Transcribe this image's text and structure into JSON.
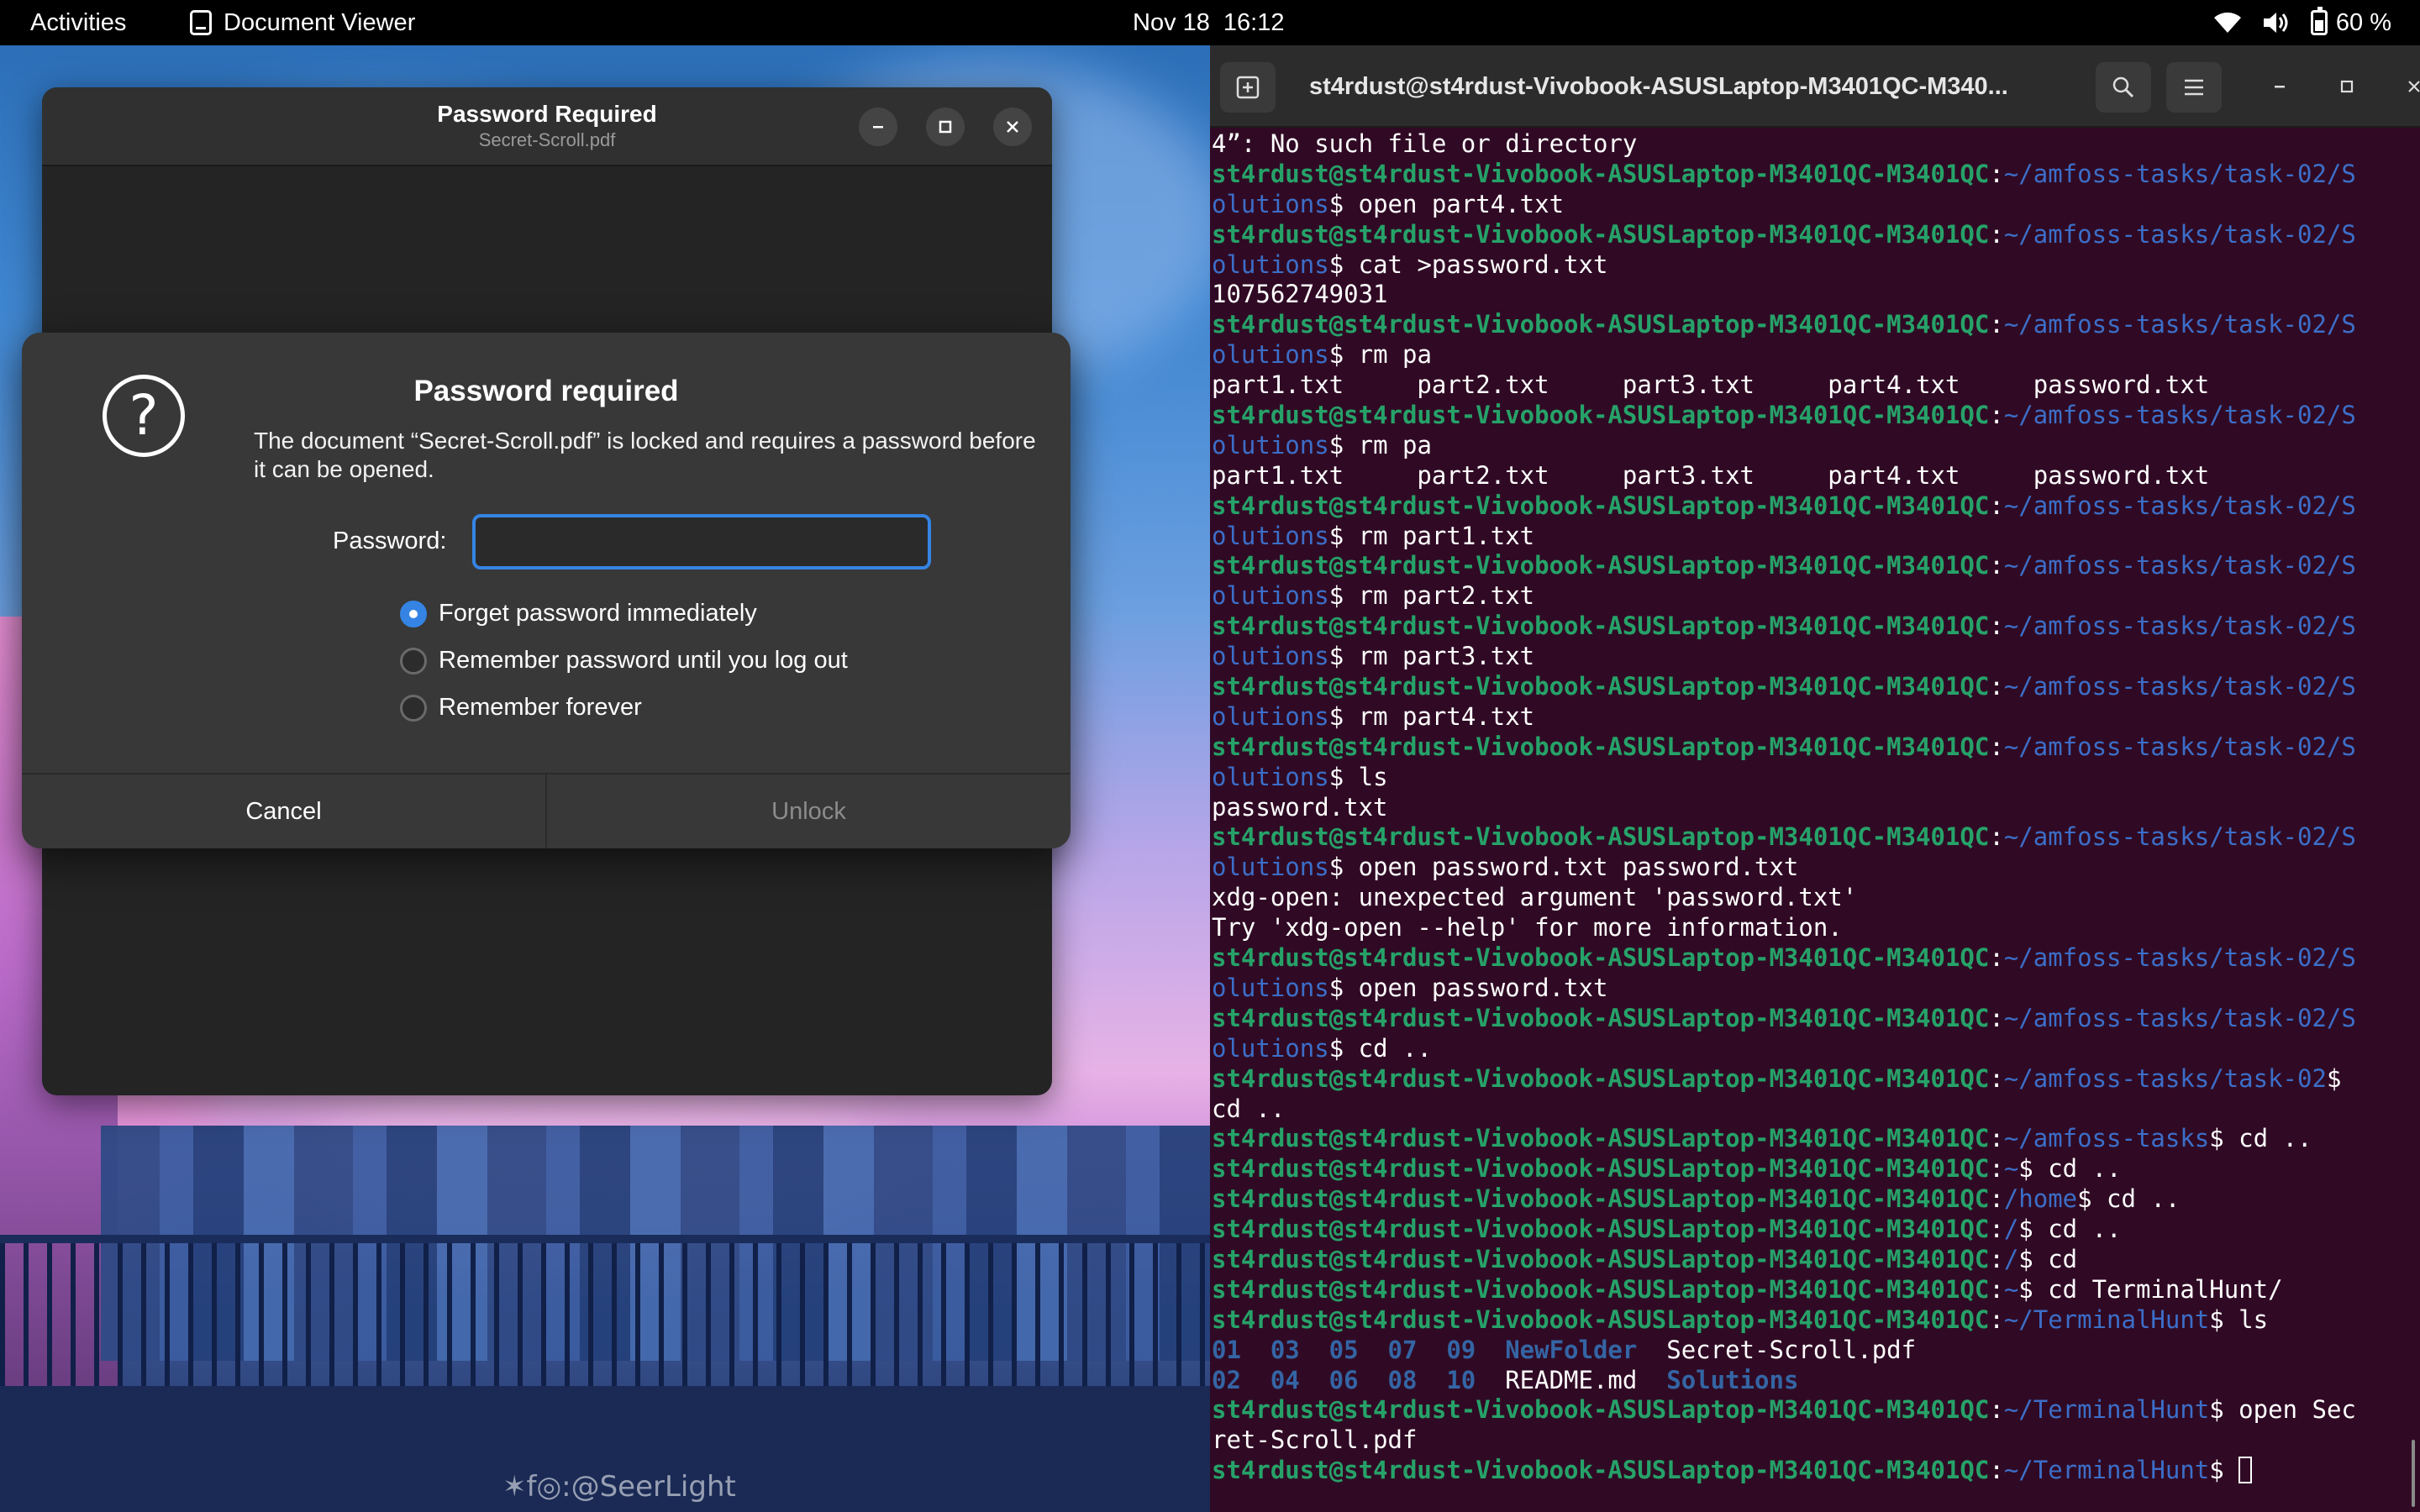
{
  "topbar": {
    "activities": "Activities",
    "app_name": "Document Viewer",
    "date": "Nov 18",
    "time": "16:12",
    "battery": "60 %"
  },
  "wallpaper": {
    "signature": "✶f◎:@SeerLight"
  },
  "viewer": {
    "title": "Password Required",
    "subtitle": "Secret-Scroll.pdf"
  },
  "dialog": {
    "title": "Password required",
    "message": "The document “Secret-Scroll.pdf” is locked and requires a password before it can be opened.",
    "password_label": "Password:",
    "password_value": "",
    "options": [
      {
        "label": "Forget password immediately",
        "checked": true
      },
      {
        "label": "Remember password until you log out",
        "checked": false
      },
      {
        "label": "Remember forever",
        "checked": false
      }
    ],
    "cancel": "Cancel",
    "unlock": "Unlock"
  },
  "terminal": {
    "title": "st4rdust@st4rdust-Vivobook-ASUSLaptop-M3401QC-M340...",
    "colors": {
      "background": "#300a24",
      "user": "#26a269",
      "path": "#3c6ec8"
    },
    "lines": [
      [
        {
          "t": "4”: No such file or directory"
        }
      ],
      [
        {
          "t": "st4rdust@st4rdust-Vivobook-ASUSLaptop-M3401QC-M3401QC",
          "c": "user"
        },
        {
          "t": ":"
        },
        {
          "t": "~/amfoss-tasks/task-02/S",
          "c": "path"
        }
      ],
      [
        {
          "t": "olutions",
          "c": "path"
        },
        {
          "t": "$ open part4.txt"
        }
      ],
      [
        {
          "t": "st4rdust@st4rdust-Vivobook-ASUSLaptop-M3401QC-M3401QC",
          "c": "user"
        },
        {
          "t": ":"
        },
        {
          "t": "~/amfoss-tasks/task-02/S",
          "c": "path"
        }
      ],
      [
        {
          "t": "olutions",
          "c": "path"
        },
        {
          "t": "$ cat >password.txt"
        }
      ],
      [
        {
          "t": "107562749031"
        }
      ],
      [
        {
          "t": "st4rdust@st4rdust-Vivobook-ASUSLaptop-M3401QC-M3401QC",
          "c": "user"
        },
        {
          "t": ":"
        },
        {
          "t": "~/amfoss-tasks/task-02/S",
          "c": "path"
        }
      ],
      [
        {
          "t": "olutions",
          "c": "path"
        },
        {
          "t": "$ rm pa"
        }
      ],
      [
        {
          "t": "part1.txt     part2.txt     part3.txt     part4.txt     password.txt"
        }
      ],
      [
        {
          "t": "st4rdust@st4rdust-Vivobook-ASUSLaptop-M3401QC-M3401QC",
          "c": "user"
        },
        {
          "t": ":"
        },
        {
          "t": "~/amfoss-tasks/task-02/S",
          "c": "path"
        }
      ],
      [
        {
          "t": "olutions",
          "c": "path"
        },
        {
          "t": "$ rm pa"
        }
      ],
      [
        {
          "t": "part1.txt     part2.txt     part3.txt     part4.txt     password.txt"
        }
      ],
      [
        {
          "t": "st4rdust@st4rdust-Vivobook-ASUSLaptop-M3401QC-M3401QC",
          "c": "user"
        },
        {
          "t": ":"
        },
        {
          "t": "~/amfoss-tasks/task-02/S",
          "c": "path"
        }
      ],
      [
        {
          "t": "olutions",
          "c": "path"
        },
        {
          "t": "$ rm part1.txt"
        }
      ],
      [
        {
          "t": "st4rdust@st4rdust-Vivobook-ASUSLaptop-M3401QC-M3401QC",
          "c": "user"
        },
        {
          "t": ":"
        },
        {
          "t": "~/amfoss-tasks/task-02/S",
          "c": "path"
        }
      ],
      [
        {
          "t": "olutions",
          "c": "path"
        },
        {
          "t": "$ rm part2.txt"
        }
      ],
      [
        {
          "t": "st4rdust@st4rdust-Vivobook-ASUSLaptop-M3401QC-M3401QC",
          "c": "user"
        },
        {
          "t": ":"
        },
        {
          "t": "~/amfoss-tasks/task-02/S",
          "c": "path"
        }
      ],
      [
        {
          "t": "olutions",
          "c": "path"
        },
        {
          "t": "$ rm part3.txt"
        }
      ],
      [
        {
          "t": "st4rdust@st4rdust-Vivobook-ASUSLaptop-M3401QC-M3401QC",
          "c": "user"
        },
        {
          "t": ":"
        },
        {
          "t": "~/amfoss-tasks/task-02/S",
          "c": "path"
        }
      ],
      [
        {
          "t": "olutions",
          "c": "path"
        },
        {
          "t": "$ rm part4.txt"
        }
      ],
      [
        {
          "t": "st4rdust@st4rdust-Vivobook-ASUSLaptop-M3401QC-M3401QC",
          "c": "user"
        },
        {
          "t": ":"
        },
        {
          "t": "~/amfoss-tasks/task-02/S",
          "c": "path"
        }
      ],
      [
        {
          "t": "olutions",
          "c": "path"
        },
        {
          "t": "$ ls"
        }
      ],
      [
        {
          "t": "password.txt"
        }
      ],
      [
        {
          "t": "st4rdust@st4rdust-Vivobook-ASUSLaptop-M3401QC-M3401QC",
          "c": "user"
        },
        {
          "t": ":"
        },
        {
          "t": "~/amfoss-tasks/task-02/S",
          "c": "path"
        }
      ],
      [
        {
          "t": "olutions",
          "c": "path"
        },
        {
          "t": "$ open password.txt password.txt"
        }
      ],
      [
        {
          "t": "xdg-open: unexpected argument 'password.txt'"
        }
      ],
      [
        {
          "t": "Try 'xdg-open --help' for more information."
        }
      ],
      [
        {
          "t": "st4rdust@st4rdust-Vivobook-ASUSLaptop-M3401QC-M3401QC",
          "c": "user"
        },
        {
          "t": ":"
        },
        {
          "t": "~/amfoss-tasks/task-02/S",
          "c": "path"
        }
      ],
      [
        {
          "t": "olutions",
          "c": "path"
        },
        {
          "t": "$ open password.txt"
        }
      ],
      [
        {
          "t": "st4rdust@st4rdust-Vivobook-ASUSLaptop-M3401QC-M3401QC",
          "c": "user"
        },
        {
          "t": ":"
        },
        {
          "t": "~/amfoss-tasks/task-02/S",
          "c": "path"
        }
      ],
      [
        {
          "t": "olutions",
          "c": "path"
        },
        {
          "t": "$ cd .."
        }
      ],
      [
        {
          "t": "st4rdust@st4rdust-Vivobook-ASUSLaptop-M3401QC-M3401QC",
          "c": "user"
        },
        {
          "t": ":"
        },
        {
          "t": "~/amfoss-tasks/task-02",
          "c": "path"
        },
        {
          "t": "$"
        }
      ],
      [
        {
          "t": "cd .."
        }
      ],
      [
        {
          "t": "st4rdust@st4rdust-Vivobook-ASUSLaptop-M3401QC-M3401QC",
          "c": "user"
        },
        {
          "t": ":"
        },
        {
          "t": "~/amfoss-tasks",
          "c": "path"
        },
        {
          "t": "$ cd .."
        }
      ],
      [
        {
          "t": "st4rdust@st4rdust-Vivobook-ASUSLaptop-M3401QC-M3401QC",
          "c": "user"
        },
        {
          "t": ":"
        },
        {
          "t": "~",
          "c": "path"
        },
        {
          "t": "$ cd .."
        }
      ],
      [
        {
          "t": "st4rdust@st4rdust-Vivobook-ASUSLaptop-M3401QC-M3401QC",
          "c": "user"
        },
        {
          "t": ":"
        },
        {
          "t": "/home",
          "c": "path"
        },
        {
          "t": "$ cd .."
        }
      ],
      [
        {
          "t": "st4rdust@st4rdust-Vivobook-ASUSLaptop-M3401QC-M3401QC",
          "c": "user"
        },
        {
          "t": ":"
        },
        {
          "t": "/",
          "c": "path"
        },
        {
          "t": "$ cd .."
        }
      ],
      [
        {
          "t": "st4rdust@st4rdust-Vivobook-ASUSLaptop-M3401QC-M3401QC",
          "c": "user"
        },
        {
          "t": ":"
        },
        {
          "t": "/",
          "c": "path"
        },
        {
          "t": "$ cd"
        }
      ],
      [
        {
          "t": "st4rdust@st4rdust-Vivobook-ASUSLaptop-M3401QC-M3401QC",
          "c": "user"
        },
        {
          "t": ":"
        },
        {
          "t": "~",
          "c": "path"
        },
        {
          "t": "$ cd TerminalHunt/"
        }
      ],
      [
        {
          "t": "st4rdust@st4rdust-Vivobook-ASUSLaptop-M3401QC-M3401QC",
          "c": "user"
        },
        {
          "t": ":"
        },
        {
          "t": "~/TerminalHunt",
          "c": "path"
        },
        {
          "t": "$ ls"
        }
      ],
      [
        {
          "t": "01  03  05  07  09  ",
          "c": "dir"
        },
        {
          "t": "NewFolder",
          "c": "dir"
        },
        {
          "t": "  Secret-Scroll.pdf"
        }
      ],
      [
        {
          "t": "02  04  06  08  10  ",
          "c": "dir"
        },
        {
          "t": "README.md  "
        },
        {
          "t": "Solutions",
          "c": "dir"
        }
      ],
      [
        {
          "t": "st4rdust@st4rdust-Vivobook-ASUSLaptop-M3401QC-M3401QC",
          "c": "user"
        },
        {
          "t": ":"
        },
        {
          "t": "~/TerminalHunt",
          "c": "path"
        },
        {
          "t": "$ open Sec"
        }
      ],
      [
        {
          "t": "ret-Scroll.pdf"
        }
      ],
      [
        {
          "t": "st4rdust@st4rdust-Vivobook-ASUSLaptop-M3401QC-M3401QC",
          "c": "user"
        },
        {
          "t": ":"
        },
        {
          "t": "~/TerminalHunt",
          "c": "path"
        },
        {
          "t": "$ "
        },
        {
          "t": "",
          "c": "cursor"
        }
      ]
    ]
  }
}
